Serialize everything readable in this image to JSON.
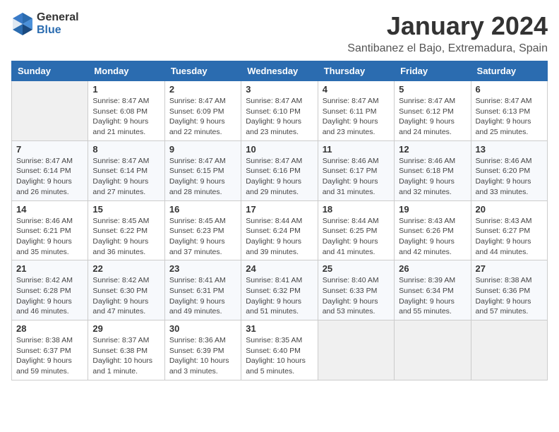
{
  "logo": {
    "general": "General",
    "blue": "Blue"
  },
  "title": "January 2024",
  "location": "Santibanez el Bajo, Extremadura, Spain",
  "weekdays": [
    "Sunday",
    "Monday",
    "Tuesday",
    "Wednesday",
    "Thursday",
    "Friday",
    "Saturday"
  ],
  "weeks": [
    [
      {
        "day": "",
        "info": ""
      },
      {
        "day": "1",
        "info": "Sunrise: 8:47 AM\nSunset: 6:08 PM\nDaylight: 9 hours\nand 21 minutes."
      },
      {
        "day": "2",
        "info": "Sunrise: 8:47 AM\nSunset: 6:09 PM\nDaylight: 9 hours\nand 22 minutes."
      },
      {
        "day": "3",
        "info": "Sunrise: 8:47 AM\nSunset: 6:10 PM\nDaylight: 9 hours\nand 23 minutes."
      },
      {
        "day": "4",
        "info": "Sunrise: 8:47 AM\nSunset: 6:11 PM\nDaylight: 9 hours\nand 23 minutes."
      },
      {
        "day": "5",
        "info": "Sunrise: 8:47 AM\nSunset: 6:12 PM\nDaylight: 9 hours\nand 24 minutes."
      },
      {
        "day": "6",
        "info": "Sunrise: 8:47 AM\nSunset: 6:13 PM\nDaylight: 9 hours\nand 25 minutes."
      }
    ],
    [
      {
        "day": "7",
        "info": "Sunrise: 8:47 AM\nSunset: 6:14 PM\nDaylight: 9 hours\nand 26 minutes."
      },
      {
        "day": "8",
        "info": "Sunrise: 8:47 AM\nSunset: 6:14 PM\nDaylight: 9 hours\nand 27 minutes."
      },
      {
        "day": "9",
        "info": "Sunrise: 8:47 AM\nSunset: 6:15 PM\nDaylight: 9 hours\nand 28 minutes."
      },
      {
        "day": "10",
        "info": "Sunrise: 8:47 AM\nSunset: 6:16 PM\nDaylight: 9 hours\nand 29 minutes."
      },
      {
        "day": "11",
        "info": "Sunrise: 8:46 AM\nSunset: 6:17 PM\nDaylight: 9 hours\nand 31 minutes."
      },
      {
        "day": "12",
        "info": "Sunrise: 8:46 AM\nSunset: 6:18 PM\nDaylight: 9 hours\nand 32 minutes."
      },
      {
        "day": "13",
        "info": "Sunrise: 8:46 AM\nSunset: 6:20 PM\nDaylight: 9 hours\nand 33 minutes."
      }
    ],
    [
      {
        "day": "14",
        "info": "Sunrise: 8:46 AM\nSunset: 6:21 PM\nDaylight: 9 hours\nand 35 minutes."
      },
      {
        "day": "15",
        "info": "Sunrise: 8:45 AM\nSunset: 6:22 PM\nDaylight: 9 hours\nand 36 minutes."
      },
      {
        "day": "16",
        "info": "Sunrise: 8:45 AM\nSunset: 6:23 PM\nDaylight: 9 hours\nand 37 minutes."
      },
      {
        "day": "17",
        "info": "Sunrise: 8:44 AM\nSunset: 6:24 PM\nDaylight: 9 hours\nand 39 minutes."
      },
      {
        "day": "18",
        "info": "Sunrise: 8:44 AM\nSunset: 6:25 PM\nDaylight: 9 hours\nand 41 minutes."
      },
      {
        "day": "19",
        "info": "Sunrise: 8:43 AM\nSunset: 6:26 PM\nDaylight: 9 hours\nand 42 minutes."
      },
      {
        "day": "20",
        "info": "Sunrise: 8:43 AM\nSunset: 6:27 PM\nDaylight: 9 hours\nand 44 minutes."
      }
    ],
    [
      {
        "day": "21",
        "info": "Sunrise: 8:42 AM\nSunset: 6:28 PM\nDaylight: 9 hours\nand 46 minutes."
      },
      {
        "day": "22",
        "info": "Sunrise: 8:42 AM\nSunset: 6:30 PM\nDaylight: 9 hours\nand 47 minutes."
      },
      {
        "day": "23",
        "info": "Sunrise: 8:41 AM\nSunset: 6:31 PM\nDaylight: 9 hours\nand 49 minutes."
      },
      {
        "day": "24",
        "info": "Sunrise: 8:41 AM\nSunset: 6:32 PM\nDaylight: 9 hours\nand 51 minutes."
      },
      {
        "day": "25",
        "info": "Sunrise: 8:40 AM\nSunset: 6:33 PM\nDaylight: 9 hours\nand 53 minutes."
      },
      {
        "day": "26",
        "info": "Sunrise: 8:39 AM\nSunset: 6:34 PM\nDaylight: 9 hours\nand 55 minutes."
      },
      {
        "day": "27",
        "info": "Sunrise: 8:38 AM\nSunset: 6:36 PM\nDaylight: 9 hours\nand 57 minutes."
      }
    ],
    [
      {
        "day": "28",
        "info": "Sunrise: 8:38 AM\nSunset: 6:37 PM\nDaylight: 9 hours\nand 59 minutes."
      },
      {
        "day": "29",
        "info": "Sunrise: 8:37 AM\nSunset: 6:38 PM\nDaylight: 10 hours\nand 1 minute."
      },
      {
        "day": "30",
        "info": "Sunrise: 8:36 AM\nSunset: 6:39 PM\nDaylight: 10 hours\nand 3 minutes."
      },
      {
        "day": "31",
        "info": "Sunrise: 8:35 AM\nSunset: 6:40 PM\nDaylight: 10 hours\nand 5 minutes."
      },
      {
        "day": "",
        "info": ""
      },
      {
        "day": "",
        "info": ""
      },
      {
        "day": "",
        "info": ""
      }
    ]
  ]
}
